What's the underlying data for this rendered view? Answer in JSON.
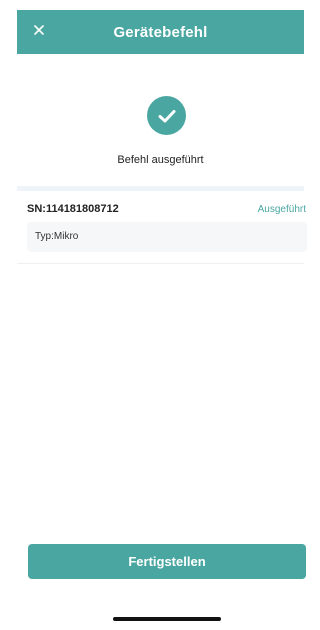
{
  "header": {
    "title": "Gerätebefehl",
    "close_icon": "close-icon"
  },
  "status": {
    "icon": "check-circle-icon",
    "message": "Befehl ausgeführt"
  },
  "device": {
    "sn": "SN:114181808712",
    "state": "Ausgeführt",
    "type": "Typ:Mikro"
  },
  "footer": {
    "finish_label": "Fertigstellen"
  },
  "colors": {
    "accent": "#4aa6a1",
    "background": "#ffffff",
    "band": "#eef4f9"
  }
}
